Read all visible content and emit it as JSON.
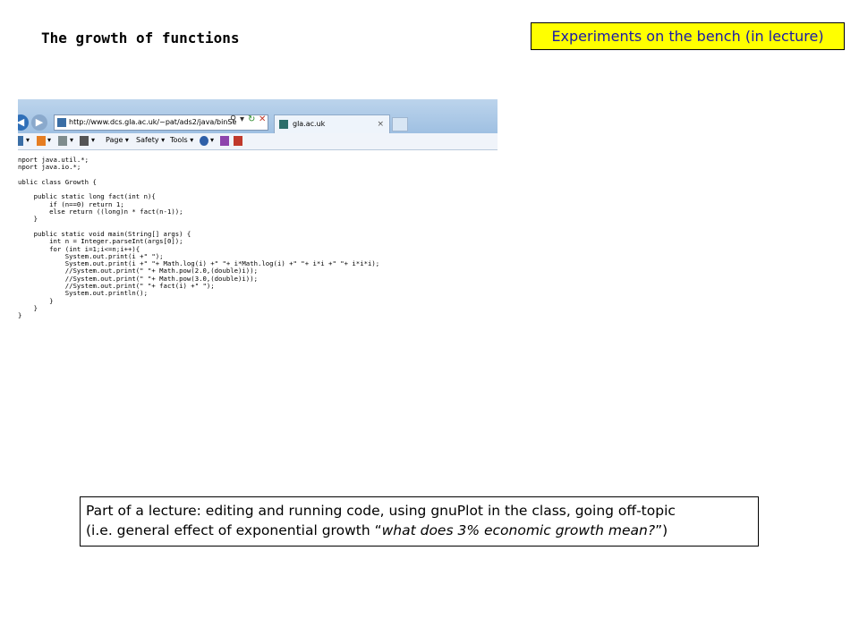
{
  "slide": {
    "title": "The growth of functions",
    "tag": "Experiments on the bench (in lecture)"
  },
  "browser": {
    "address": "http://www.dcs.gla.ac.uk/~pat/ads2/java/binSe",
    "tab_title": "gla.ac.uk",
    "tab_close": "×",
    "menu": {
      "page": "Page ▾",
      "safety": "Safety ▾",
      "tools": "Tools ▾"
    },
    "icons": [
      "back-icon",
      "forward-icon",
      "search-icon",
      "refresh-icon",
      "stop-icon",
      "home-icon",
      "feeds-icon",
      "mail-icon",
      "print-icon",
      "help-icon",
      "onenote-icon"
    ],
    "code": "nport java.util.*;\nnport java.io.*;\n\nublic class Growth {\n\n    public static long fact(int n){\n        if (n==0) return 1;\n        else return ((long)n * fact(n-1));\n    }\n\n    public static void main(String[] args) {\n        int n = Integer.parseInt(args[0]);\n        for (int i=1;i<=n;i++){\n            System.out.print(i +\" \");\n            System.out.print(i +\" \"+ Math.log(i) +\" \"+ i*Math.log(i) +\" \"+ i*i +\" \"+ i*i*i);\n            //System.out.print(\" \"+ Math.pow(2.0,(double)i));\n            //System.out.print(\" \"+ Math.pow(3.0,(double)i));\n            //System.out.print(\" \"+ fact(i) +\" \");\n            System.out.println();\n        }\n    }\n}"
  },
  "caption": {
    "line1": "Part of a lecture: editing and running code, using gnuPlot in the class, going off-topic",
    "line2_start": "(i.e. general effect of exponential growth “",
    "line2_italic": "what does 3% economic growth mean?",
    "line2_end": "”)"
  }
}
